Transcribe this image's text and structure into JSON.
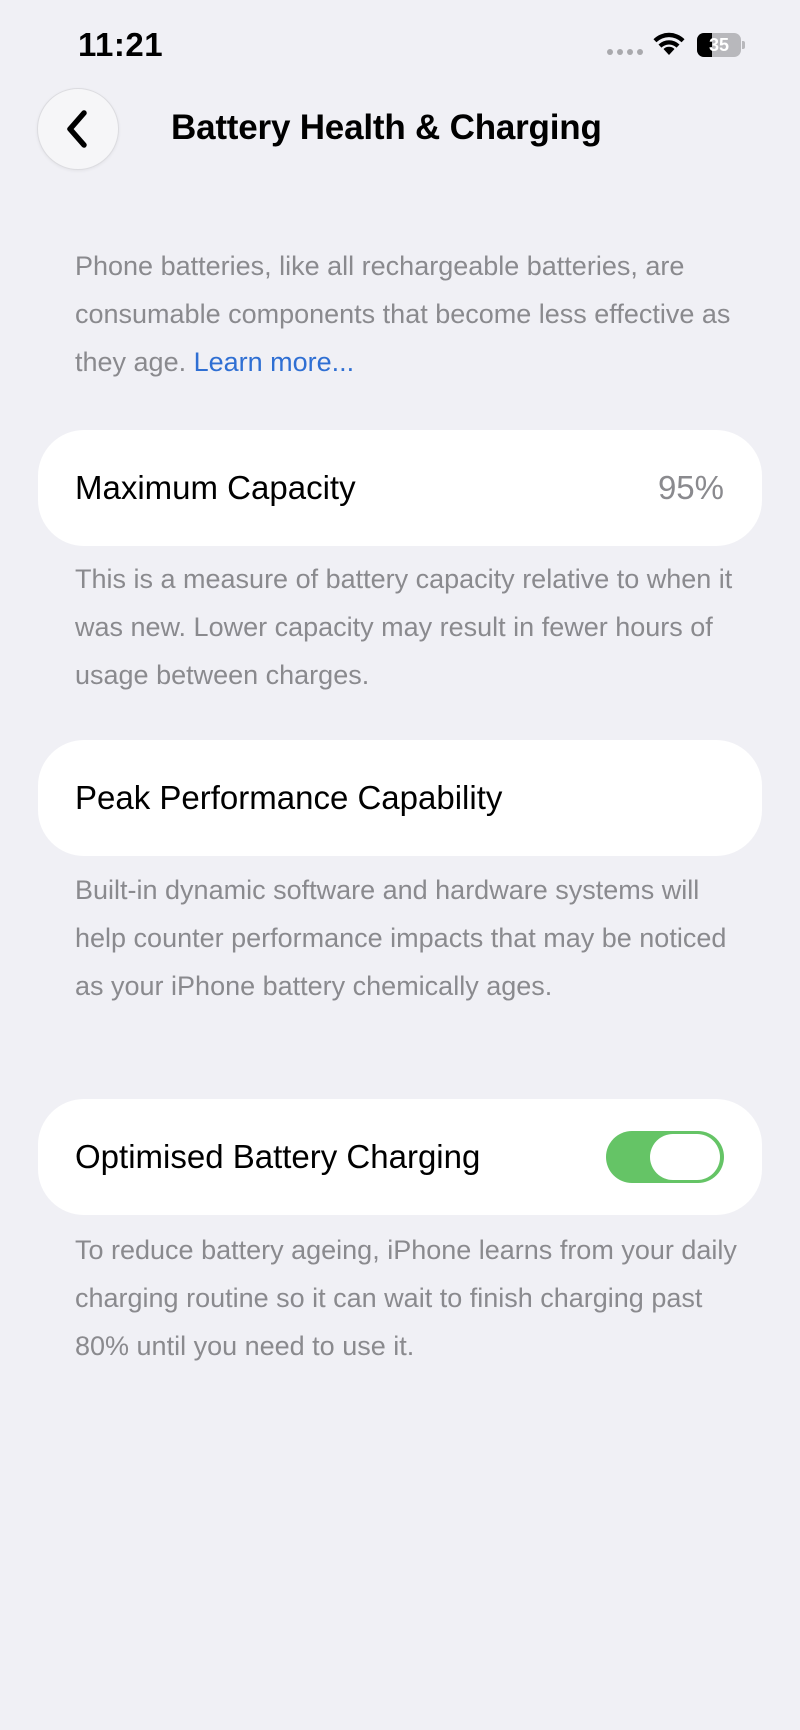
{
  "status_bar": {
    "time": "11:21",
    "battery_level": "35",
    "battery_percent": 35,
    "icons": [
      "signal-dots",
      "wifi-icon",
      "battery-icon"
    ]
  },
  "header": {
    "back_icon": "chevron-left-icon",
    "title": "Battery Health & Charging"
  },
  "intro": {
    "text": "Phone batteries, like all rechargeable batteries, are consumable components that become less effective as they age.",
    "link": "Learn more..."
  },
  "maximum_capacity": {
    "label": "Maximum Capacity",
    "value": "95%",
    "description": "This is a measure of battery capacity relative to when it was new. Lower capacity may result in fewer hours of usage between charges."
  },
  "peak_performance": {
    "label": "Peak Performance Capability",
    "description": "Built-in dynamic software and hardware systems will help counter performance impacts that may be noticed as your iPhone battery chemically ages."
  },
  "optimised_charging": {
    "label": "Optimised Battery Charging",
    "enabled": true,
    "description": "To reduce battery ageing, iPhone learns from your daily charging routine so it can wait to finish charging past 80% until you need to use it."
  },
  "colors": {
    "background": "#f0f0f5",
    "card": "#ffffff",
    "secondary_text": "#8a8a8e",
    "link": "#2f6fd3",
    "toggle_on": "#65c466"
  }
}
